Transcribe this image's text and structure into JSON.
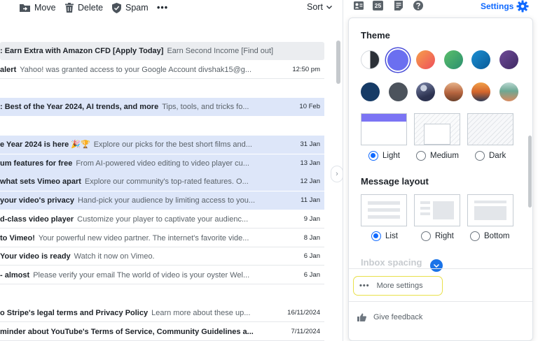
{
  "toolbar": {
    "move_label": "Move",
    "delete_label": "Delete",
    "spam_label": "Spam",
    "more_label": "•••",
    "sort_label": "Sort"
  },
  "emails": [
    {
      "sender": ": Earn Extra with Amazon CFD [Apply Today]",
      "snippet": "Earn Second Income [Find out]",
      "date": ""
    },
    {
      "sender": "alert",
      "snippet": "Yahoo! was granted access to your Google Account divshak15@g...",
      "date": "12:50 pm"
    },
    {
      "sender": ": Best of the Year 2024, AI trends, and more",
      "snippet": "Tips, tools, and tricks fo...",
      "date": "10 Feb"
    },
    {
      "sender": "e Year 2024 is here 🎉🏆",
      "snippet": "Explore our picks for the best short films and...",
      "date": "31 Jan"
    },
    {
      "sender": "um features for free",
      "snippet": "From AI-powered video editing to video player cu...",
      "date": "13 Jan"
    },
    {
      "sender": "what sets Vimeo apart",
      "snippet": "Explore our community's top-rated features. O...",
      "date": "12 Jan"
    },
    {
      "sender": "your video's privacy",
      "snippet": "Hand-pick your audience by limiting access to you...",
      "date": "11 Jan"
    },
    {
      "sender": "d-class video player",
      "snippet": "Customize your player to captivate your audienc...",
      "date": "9 Jan"
    },
    {
      "sender": "to Vimeo!",
      "snippet": "Your powerful new video partner. The internet's favorite vide...",
      "date": "8 Jan"
    },
    {
      "sender": "Your video is ready",
      "snippet": "Watch it now on Vimeo.",
      "date": "6 Jan"
    },
    {
      "sender": "- almost",
      "snippet": "Please verify your email The world of video is your oyster Wel...",
      "date": "6 Jan"
    },
    {
      "sender": "o Stripe's legal terms and Privacy Policy",
      "snippet": "Learn more about these up...",
      "date": "16/11/2024"
    },
    {
      "sender": "minder about YouTube's Terms of Service, Community Guidelines a...",
      "snippet": "",
      "date": "7/11/2024"
    }
  ],
  "header": {
    "calendar_day": "25",
    "settings_label": "Settings"
  },
  "settings": {
    "theme_title": "Theme",
    "theme_swatches": [
      {
        "name": "light-dark",
        "color": "#ffffff"
      },
      {
        "name": "blue-violet",
        "color": "#6b6ff0"
      },
      {
        "name": "orange",
        "color": "#f2734a"
      },
      {
        "name": "green",
        "color": "#35a86a"
      },
      {
        "name": "blue",
        "color": "#0b6fb0"
      },
      {
        "name": "purple",
        "color": "#5b3b83"
      },
      {
        "name": "navy",
        "color": "#163b66"
      },
      {
        "name": "gray",
        "color": "#4c535c"
      },
      {
        "name": "photo-mountains",
        "color": "#4a4f6d"
      },
      {
        "name": "photo-canyon",
        "color": "#c4774e"
      },
      {
        "name": "photo-sunset",
        "color": "#d9752e"
      },
      {
        "name": "photo-beach",
        "color": "#5f9a84"
      }
    ],
    "theme_options": [
      "Light",
      "Medium",
      "Dark"
    ],
    "theme_selected": "Light",
    "layout_title": "Message layout",
    "layout_options": [
      "List",
      "Right",
      "Bottom"
    ],
    "layout_selected": "List",
    "spacing_title": "Inbox spacing",
    "more_settings_label": "More settings",
    "feedback_label": "Give feedback"
  },
  "colors": {
    "accent": "#0f69ff",
    "selected_row": "#dde6f9",
    "highlight_border": "#e9e04a"
  }
}
